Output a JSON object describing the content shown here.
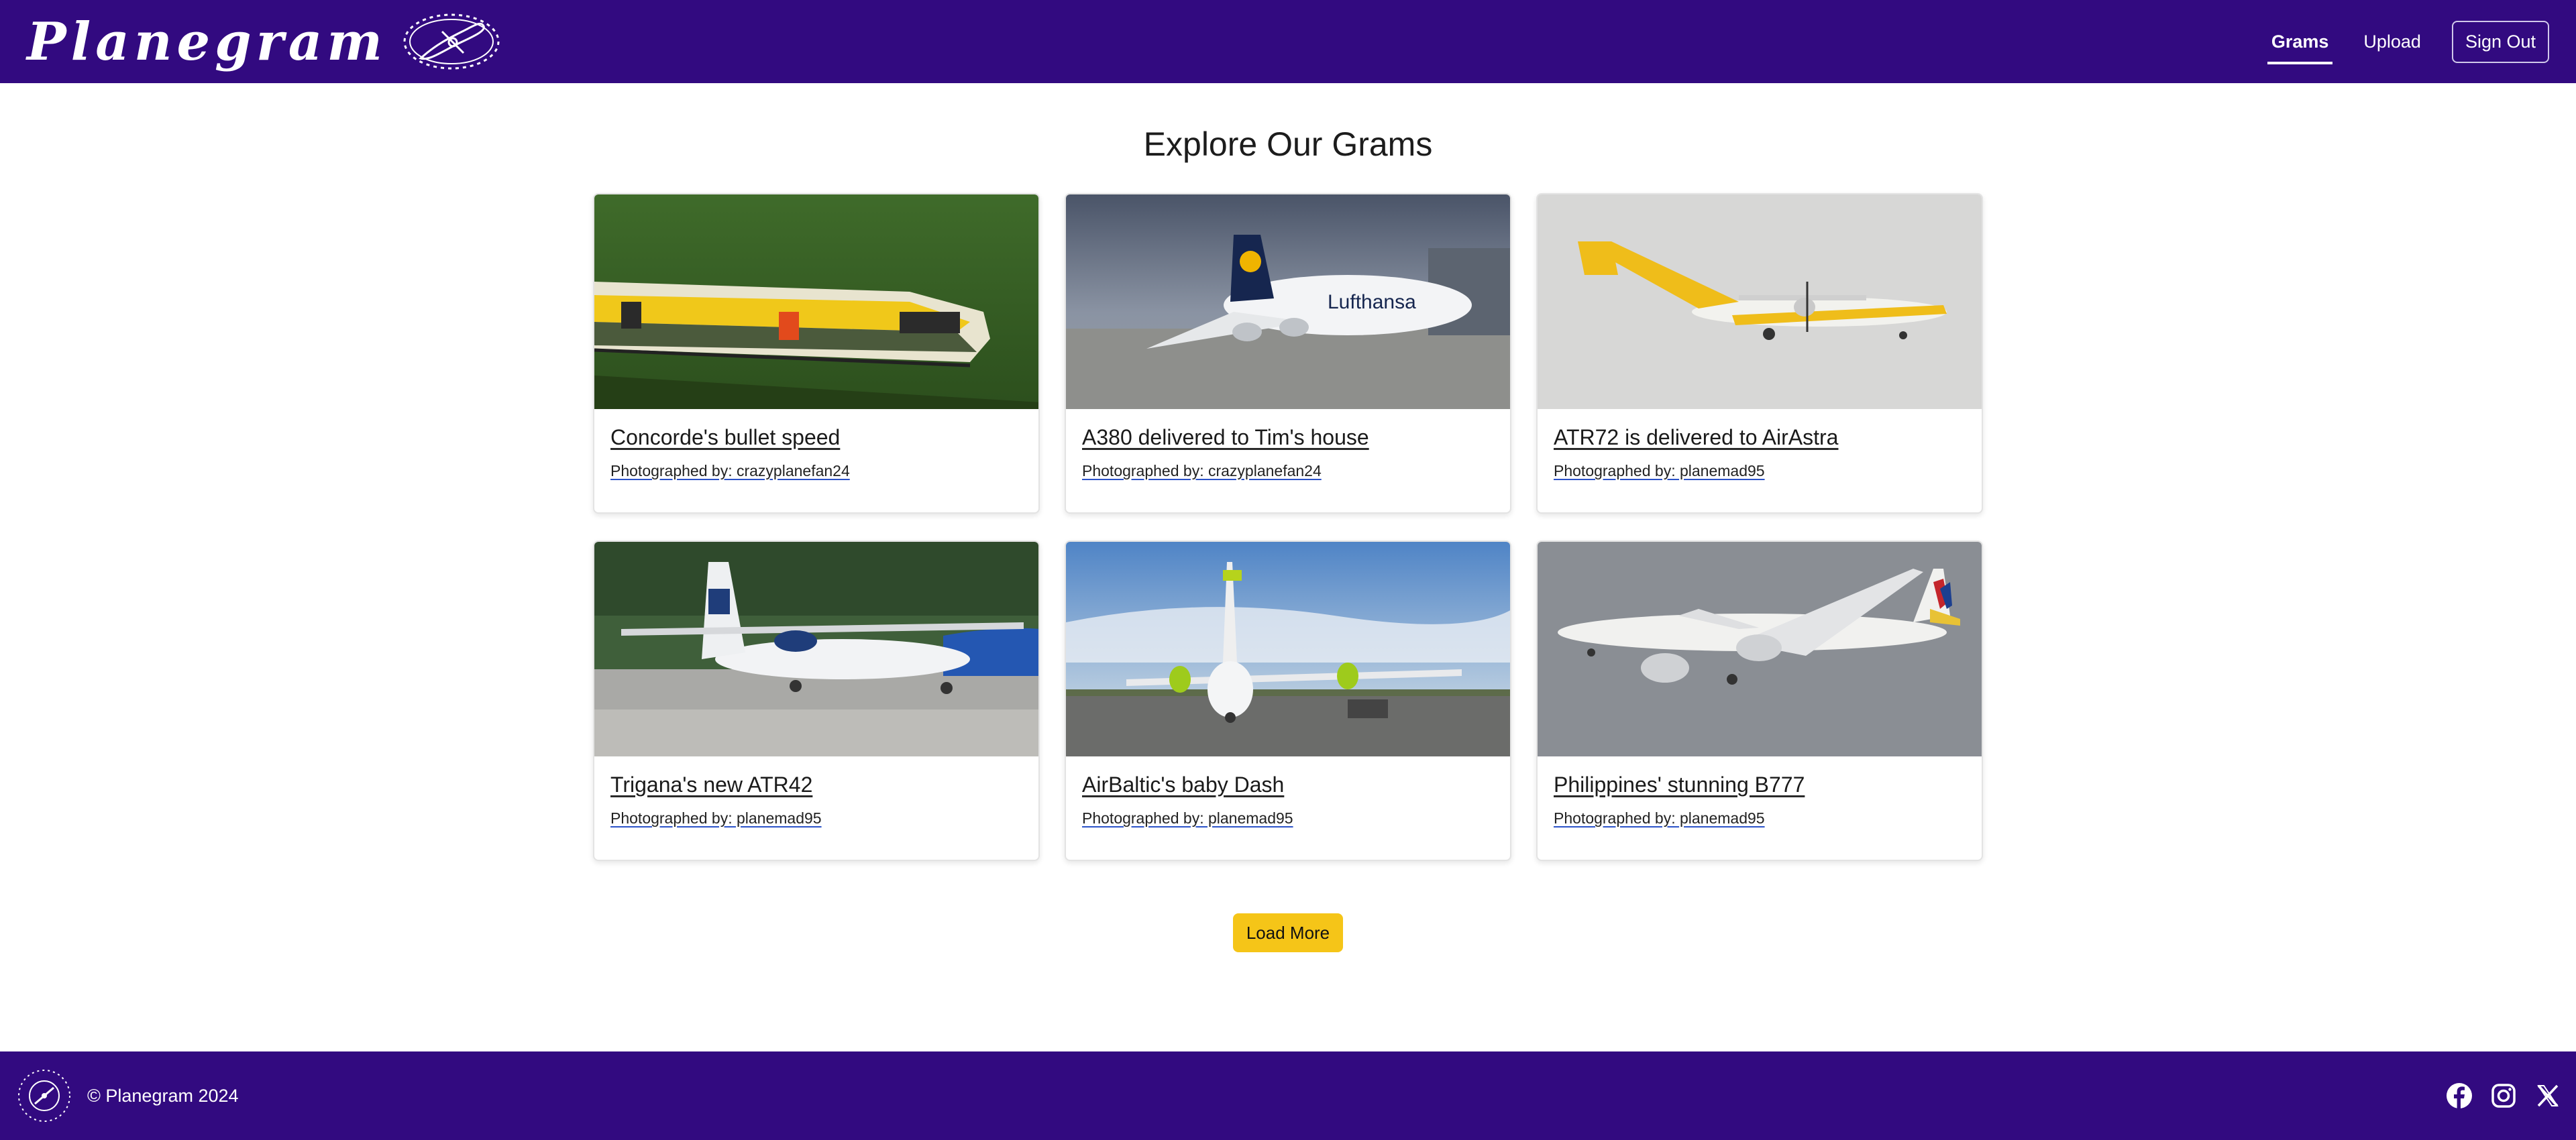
{
  "header": {
    "brand": "Planegram",
    "nav": {
      "grams": "Grams",
      "upload": "Upload",
      "sign_out": "Sign Out"
    }
  },
  "main": {
    "title": "Explore Our Grams",
    "cards": [
      {
        "title": "Concorde's bullet speed",
        "credit": "Photographed by: crazyplanefan24"
      },
      {
        "title": "A380 delivered to Tim's house",
        "credit": "Photographed by: crazyplanefan24"
      },
      {
        "title": "ATR72 is delivered to AirAstra",
        "credit": "Photographed by: planemad95"
      },
      {
        "title": "Trigana's new ATR42",
        "credit": "Photographed by: planemad95"
      },
      {
        "title": "AirBaltic's baby Dash",
        "credit": "Photographed by: planemad95"
      },
      {
        "title": "Philippines' stunning B777",
        "credit": "Photographed by: planemad95"
      }
    ],
    "load_more": "Load More"
  },
  "footer": {
    "copyright": "© Planegram 2024",
    "social": [
      "facebook-icon",
      "instagram-icon",
      "x-icon"
    ]
  },
  "colors": {
    "nav_bg": "#320a80",
    "accent_button": "#f5c518",
    "text": "#212529"
  }
}
